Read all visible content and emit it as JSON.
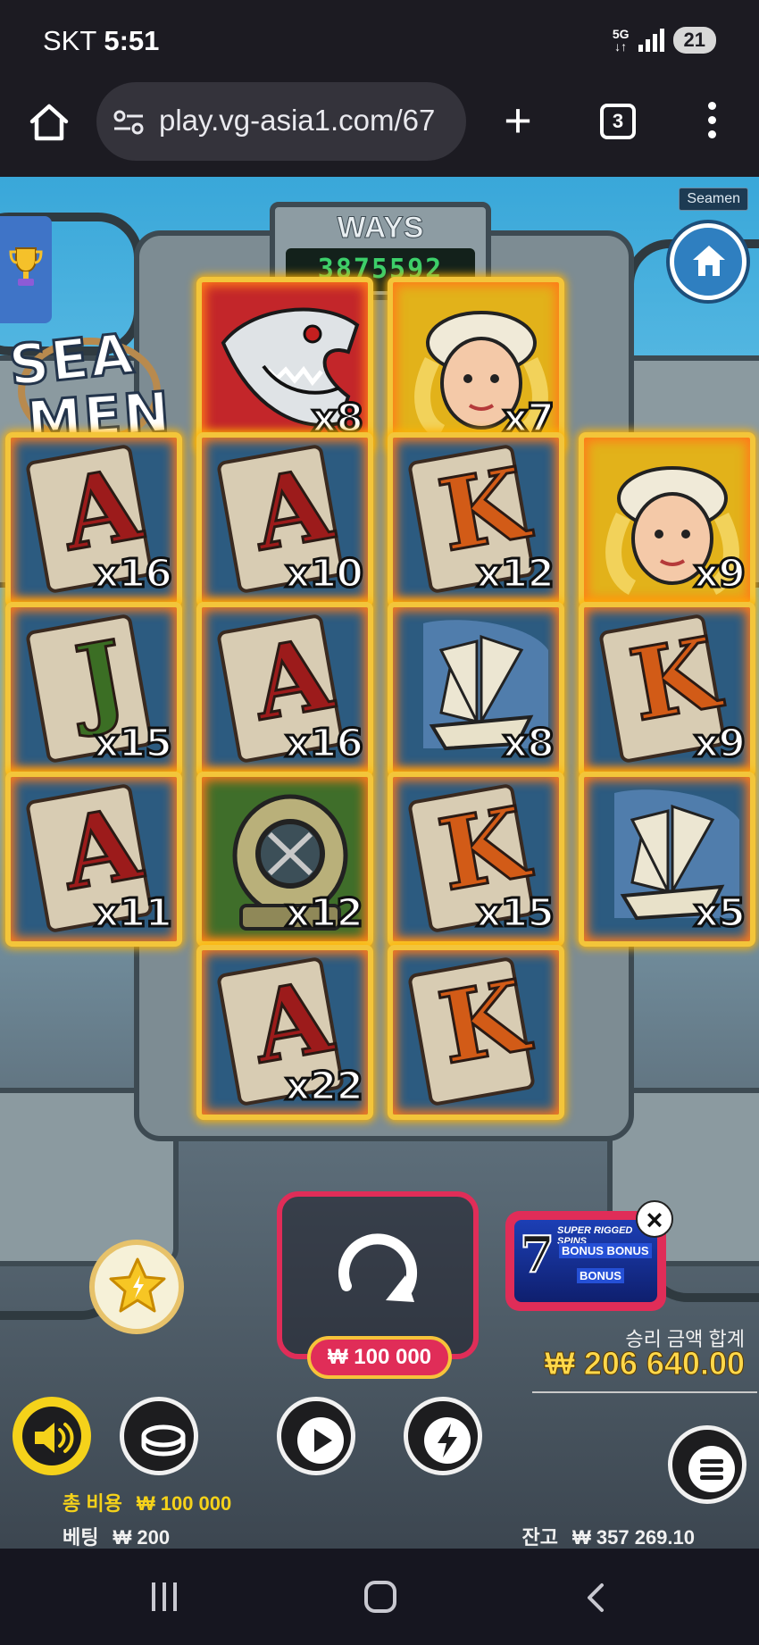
{
  "status_bar": {
    "carrier": "SKT",
    "time": "5:51",
    "network": "5G",
    "battery": "21"
  },
  "browser": {
    "url": "play.vg-asia1.com/67",
    "tab_count": "3"
  },
  "game": {
    "provider_tag": "Seamen",
    "logo_line1": "SEA",
    "logo_line2": "MEN",
    "ways_label": "WAYS",
    "ways_value": "3875592"
  },
  "reels": [
    {
      "symbol": "shark-icon",
      "multiplier": "x8",
      "bg": "red"
    },
    {
      "symbol": "sailor-girl-icon",
      "multiplier": "x7",
      "bg": "yellow"
    },
    {
      "symbol": "card-a",
      "glyph": "A",
      "multiplier": "x16"
    },
    {
      "symbol": "card-a",
      "glyph": "A",
      "multiplier": "x10"
    },
    {
      "symbol": "card-k",
      "glyph": "K",
      "multiplier": "x12"
    },
    {
      "symbol": "sailor-girl-icon",
      "multiplier": "x9",
      "bg": "yellow"
    },
    {
      "symbol": "card-j",
      "glyph": "J",
      "multiplier": "x15"
    },
    {
      "symbol": "card-a",
      "glyph": "A",
      "multiplier": "x16"
    },
    {
      "symbol": "ship-icon",
      "multiplier": "x8"
    },
    {
      "symbol": "card-k",
      "glyph": "K",
      "multiplier": "x9"
    },
    {
      "symbol": "card-a",
      "glyph": "A",
      "multiplier": "x11"
    },
    {
      "symbol": "diving-helmet-icon",
      "multiplier": "x12",
      "bg": "green"
    },
    {
      "symbol": "card-k",
      "glyph": "K",
      "multiplier": "x15"
    },
    {
      "symbol": "ship-icon",
      "multiplier": "x5"
    },
    {
      "symbol": "card-a",
      "glyph": "A",
      "multiplier": "x22"
    },
    {
      "symbol": "card-k",
      "glyph": "K",
      "multiplier": ""
    }
  ],
  "controls": {
    "spin_amount": "₩ 100 000",
    "bonus_card": {
      "number": "7",
      "title": "SUPER RIGGED SPINS",
      "bonus1": "BONUS BONUS",
      "bonus2": "BONUS"
    },
    "win_label": "승리 금액 합계",
    "win_value": "₩ 206 640.00",
    "total_cost_label": "총 비용",
    "total_cost_value": "₩ 100 000",
    "bet_label": "베팅",
    "bet_value": "₩ 200",
    "balance_label": "잔고",
    "balance_value": "₩ 357 269.10"
  },
  "colors": {
    "accent_red": "#e02d58",
    "win_yellow": "#ffd84a",
    "ways_green": "#3ccf6a"
  }
}
